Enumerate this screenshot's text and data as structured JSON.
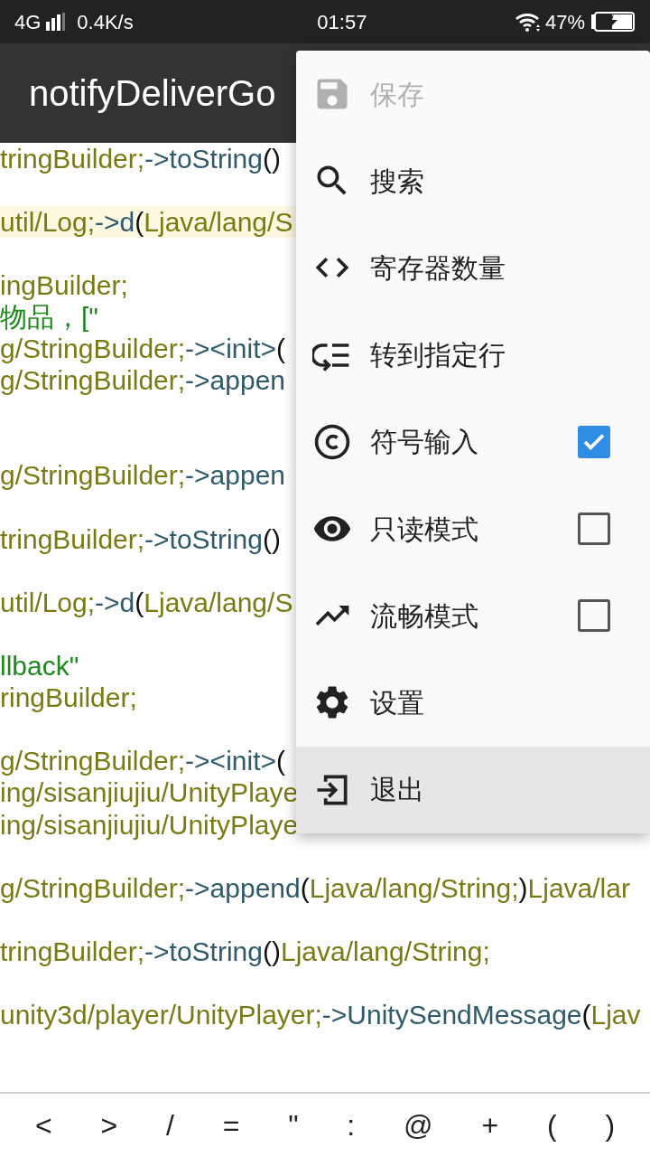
{
  "status_bar": {
    "network": "4G",
    "speed": "0.4K/s",
    "time": "01:57",
    "battery": "47%"
  },
  "title": "notifyDeliverGo",
  "code_lines": [
    {
      "kind": "code",
      "highlighted": false,
      "segments": [
        {
          "kind": "type",
          "text": "tringBuilder;"
        },
        {
          "kind": "method",
          "text": "->toString"
        },
        {
          "kind": "punct",
          "text": "()"
        }
      ]
    },
    {
      "kind": "blank"
    },
    {
      "kind": "code",
      "highlighted": true,
      "segments": [
        {
          "kind": "type",
          "text": "util/Log;"
        },
        {
          "kind": "method",
          "text": "->d"
        },
        {
          "kind": "punct",
          "text": "("
        },
        {
          "kind": "type",
          "text": "Ljava/lang/S"
        }
      ]
    },
    {
      "kind": "blank"
    },
    {
      "kind": "code",
      "highlighted": false,
      "segments": [
        {
          "kind": "type",
          "text": "ingBuilder;"
        }
      ]
    },
    {
      "kind": "code",
      "highlighted": false,
      "segments": [
        {
          "kind": "string",
          "text": "物品，[\""
        }
      ]
    },
    {
      "kind": "code",
      "highlighted": false,
      "segments": [
        {
          "kind": "type",
          "text": "g/StringBuilder;"
        },
        {
          "kind": "method",
          "text": "-><init>"
        },
        {
          "kind": "punct",
          "text": "("
        }
      ]
    },
    {
      "kind": "code",
      "highlighted": false,
      "segments": [
        {
          "kind": "type",
          "text": "g/StringBuilder;"
        },
        {
          "kind": "method",
          "text": "->appen"
        }
      ]
    },
    {
      "kind": "blank"
    },
    {
      "kind": "blank"
    },
    {
      "kind": "code",
      "highlighted": false,
      "segments": [
        {
          "kind": "type",
          "text": "g/StringBuilder;"
        },
        {
          "kind": "method",
          "text": "->appen"
        }
      ]
    },
    {
      "kind": "blank"
    },
    {
      "kind": "code",
      "highlighted": false,
      "segments": [
        {
          "kind": "type",
          "text": "tringBuilder;"
        },
        {
          "kind": "method",
          "text": "->toString"
        },
        {
          "kind": "punct",
          "text": "()"
        }
      ]
    },
    {
      "kind": "blank"
    },
    {
      "kind": "code",
      "highlighted": false,
      "segments": [
        {
          "kind": "type",
          "text": "util/Log;"
        },
        {
          "kind": "method",
          "text": "->d"
        },
        {
          "kind": "punct",
          "text": "("
        },
        {
          "kind": "type",
          "text": "Ljava/lang/S"
        }
      ]
    },
    {
      "kind": "blank"
    },
    {
      "kind": "code",
      "highlighted": false,
      "segments": [
        {
          "kind": "string",
          "text": "llback\""
        }
      ]
    },
    {
      "kind": "code",
      "highlighted": false,
      "segments": [
        {
          "kind": "type",
          "text": "ringBuilder;"
        }
      ]
    },
    {
      "kind": "blank"
    },
    {
      "kind": "code",
      "highlighted": false,
      "segments": [
        {
          "kind": "type",
          "text": "g/StringBuilder;"
        },
        {
          "kind": "method",
          "text": "-><init>"
        },
        {
          "kind": "punct",
          "text": "("
        }
      ]
    },
    {
      "kind": "code",
      "highlighted": false,
      "segments": [
        {
          "kind": "type",
          "text": "ing/sisanjiujiu/UnityPlaye"
        }
      ]
    },
    {
      "kind": "code",
      "highlighted": false,
      "segments": [
        {
          "kind": "type",
          "text": "ing/sisanjiujiu/UnityPlaye"
        }
      ]
    },
    {
      "kind": "blank"
    },
    {
      "kind": "code",
      "highlighted": false,
      "segments": [
        {
          "kind": "type",
          "text": "g/StringBuilder;"
        },
        {
          "kind": "method",
          "text": "->append"
        },
        {
          "kind": "punct",
          "text": "("
        },
        {
          "kind": "type",
          "text": "Ljava/lang/String;"
        },
        {
          "kind": "punct",
          "text": ")"
        },
        {
          "kind": "type",
          "text": "Ljava/lar"
        }
      ]
    },
    {
      "kind": "blank"
    },
    {
      "kind": "code",
      "highlighted": false,
      "segments": [
        {
          "kind": "type",
          "text": "tringBuilder;"
        },
        {
          "kind": "method",
          "text": "->toString"
        },
        {
          "kind": "punct",
          "text": "()"
        },
        {
          "kind": "type",
          "text": "Ljava/lang/String;"
        }
      ]
    },
    {
      "kind": "blank"
    },
    {
      "kind": "code",
      "highlighted": false,
      "segments": [
        {
          "kind": "type",
          "text": "unity3d/player/UnityPlayer;"
        },
        {
          "kind": "method",
          "text": "->UnitySendMessage"
        },
        {
          "kind": "punct",
          "text": "("
        },
        {
          "kind": "type",
          "text": "Ljav"
        }
      ]
    }
  ],
  "menu": [
    {
      "kind": "plain",
      "label": "保存",
      "disabled": true,
      "selected": false
    },
    {
      "kind": "plain",
      "label": "搜索",
      "disabled": false,
      "selected": false
    },
    {
      "kind": "plain",
      "label": "寄存器数量",
      "disabled": false,
      "selected": false
    },
    {
      "kind": "plain",
      "label": "转到指定行",
      "disabled": false,
      "selected": false
    },
    {
      "kind": "checkbox",
      "label": "符号输入",
      "disabled": false,
      "selected": false,
      "checked": true
    },
    {
      "kind": "checkbox",
      "label": "只读模式",
      "disabled": false,
      "selected": false,
      "checked": false
    },
    {
      "kind": "checkbox",
      "label": "流畅模式",
      "disabled": false,
      "selected": false,
      "checked": false
    },
    {
      "kind": "plain",
      "label": "设置",
      "disabled": false,
      "selected": false
    },
    {
      "kind": "plain",
      "label": "退出",
      "disabled": false,
      "selected": true
    }
  ],
  "symbol_keys": [
    "<",
    ">",
    "/",
    "=",
    "\"",
    ":",
    "@",
    "+",
    "(",
    ")"
  ]
}
